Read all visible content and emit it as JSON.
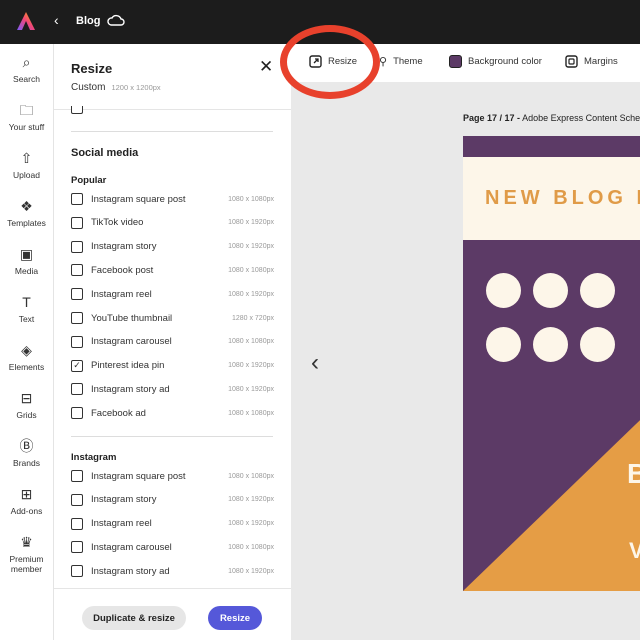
{
  "header": {
    "title": "Blog"
  },
  "rail": [
    {
      "label": "Search",
      "icon": "search-icon"
    },
    {
      "label": "Your stuff",
      "icon": "folder-icon"
    },
    {
      "label": "Upload",
      "icon": "upload-icon"
    },
    {
      "label": "Templates",
      "icon": "templates-icon"
    },
    {
      "label": "Media",
      "icon": "media-icon"
    },
    {
      "label": "Text",
      "icon": "text-icon"
    },
    {
      "label": "Elements",
      "icon": "elements-icon"
    },
    {
      "label": "Grids",
      "icon": "grids-icon"
    },
    {
      "label": "Brands",
      "icon": "brands-icon"
    },
    {
      "label": "Add-ons",
      "icon": "addons-icon"
    },
    {
      "label": "Premium member",
      "icon": "crown-icon"
    }
  ],
  "panel": {
    "title": "Resize",
    "custom_label": "Custom",
    "custom_size": "1200 x 1200px",
    "section": "Social media",
    "popular_label": "Popular",
    "popular": [
      {
        "label": "Instagram square post",
        "size": "1080 x 1080px",
        "checked": false
      },
      {
        "label": "TikTok video",
        "size": "1080 x 1920px",
        "checked": false
      },
      {
        "label": "Instagram story",
        "size": "1080 x 1920px",
        "checked": false
      },
      {
        "label": "Facebook post",
        "size": "1080 x 1080px",
        "checked": false
      },
      {
        "label": "Instagram reel",
        "size": "1080 x 1920px",
        "checked": false
      },
      {
        "label": "YouTube thumbnail",
        "size": "1280 x 720px",
        "checked": false
      },
      {
        "label": "Instagram carousel",
        "size": "1080 x 1080px",
        "checked": false
      },
      {
        "label": "Pinterest idea pin",
        "size": "1080 x 1920px",
        "checked": true
      },
      {
        "label": "Instagram story ad",
        "size": "1080 x 1920px",
        "checked": false
      },
      {
        "label": "Facebook ad",
        "size": "1080 x 1080px",
        "checked": false
      }
    ],
    "instagram_label": "Instagram",
    "instagram": [
      {
        "label": "Instagram square post",
        "size": "1080 x 1080px",
        "checked": false
      },
      {
        "label": "Instagram story",
        "size": "1080 x 1920px",
        "checked": false
      },
      {
        "label": "Instagram reel",
        "size": "1080 x 1920px",
        "checked": false
      },
      {
        "label": "Instagram carousel",
        "size": "1080 x 1080px",
        "checked": false
      },
      {
        "label": "Instagram story ad",
        "size": "1080 x 1920px",
        "checked": false
      }
    ],
    "duplicate_button": "Duplicate & resize",
    "resize_button": "Resize"
  },
  "toolbar": {
    "resize": "Resize",
    "theme": "Theme",
    "background_color": "Background color",
    "margins": "Margins",
    "bg_swatch": "#5c3a66"
  },
  "canvas": {
    "page_label": "Page 17 / 17 -",
    "doc_title": "Adobe Express Content Sche",
    "headline": "NEW BLOG P",
    "text_b": "B",
    "text_w": "V"
  },
  "colors": {
    "accent": "#5558d9",
    "annotation": "#e8412c",
    "purple": "#5c3a66",
    "orange": "#e59d45",
    "cream": "#fdf6e9"
  }
}
